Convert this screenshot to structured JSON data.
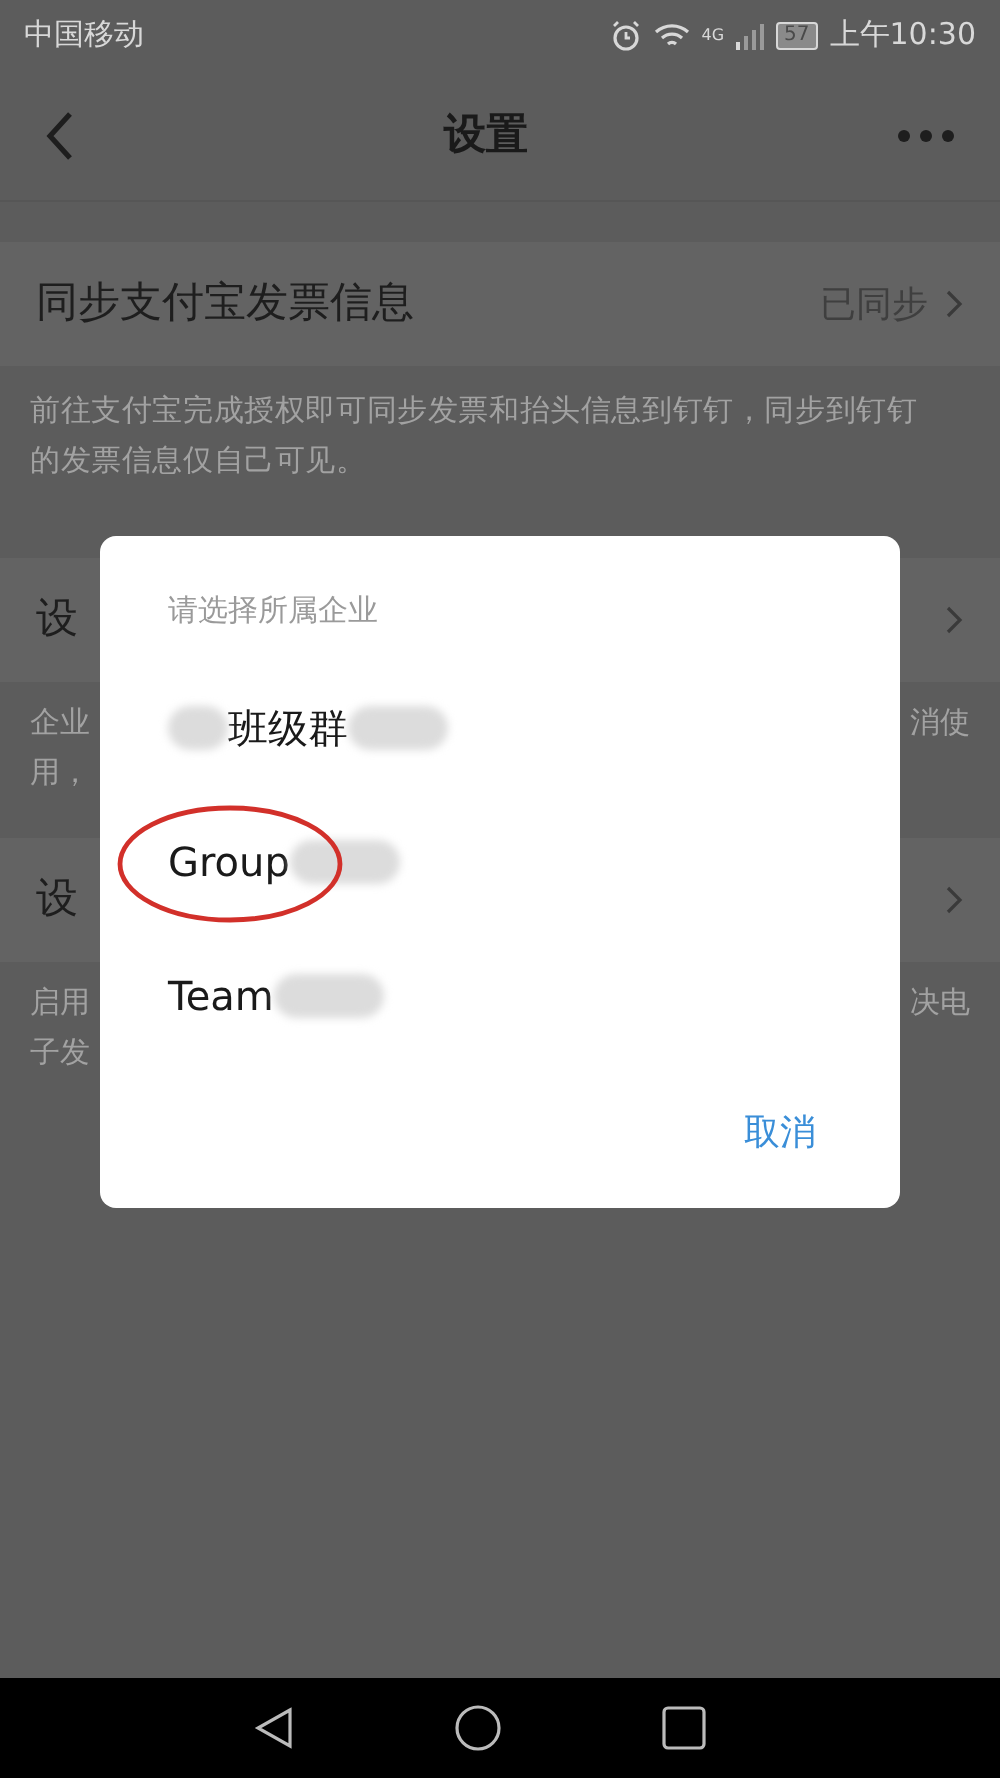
{
  "status_bar": {
    "carrier": "中国移动",
    "battery": "57",
    "time": "上午10:30",
    "network": "4G"
  },
  "header": {
    "title": "设置"
  },
  "rows": [
    {
      "title": "同步支付宝发票信息",
      "value": "已同步",
      "description": "前往支付宝完成授权即可同步发票和抬头信息到钉钉，同步到钉钉的发票信息仅自己可见。"
    },
    {
      "title": "设",
      "value": "",
      "description_left": [
        "企业",
        "用，"
      ],
      "description_right": [
        "消使"
      ]
    },
    {
      "title": "设",
      "value": "",
      "description_left": [
        "启用",
        "子发"
      ],
      "description_right": [
        "决电"
      ]
    }
  ],
  "dialog": {
    "title": "请选择所属企业",
    "options": [
      {
        "label": "班级群",
        "blur_before": true,
        "highlighted": false
      },
      {
        "label": "Group",
        "blur_before": false,
        "highlighted": true
      },
      {
        "label": "Team",
        "blur_before": false,
        "highlighted": false
      }
    ],
    "cancel": "取消"
  }
}
